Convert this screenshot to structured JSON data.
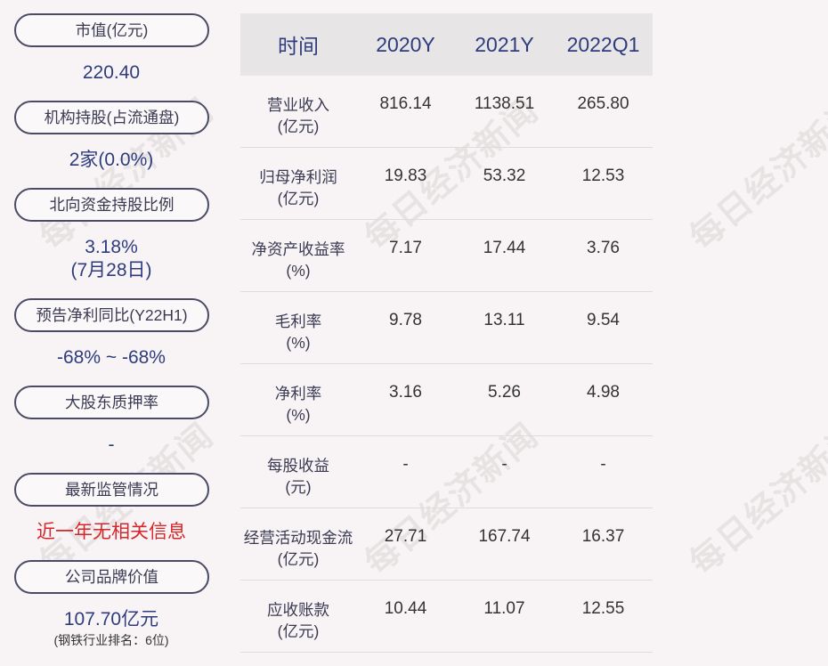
{
  "left_panel": [
    {
      "label": "市值(亿元)",
      "value": "220.40"
    },
    {
      "label": "机构持股(占流通盘)",
      "value": "2家(0.0%)"
    },
    {
      "label": "北向资金持股比例",
      "value": "3.18%",
      "value2": "(7月28日)"
    },
    {
      "label": "预告净利同比(Y22H1)",
      "value": "-68% ~ -68%"
    },
    {
      "label": "大股东质押率",
      "value": "-"
    },
    {
      "label": "最新监管情况",
      "value": "近一年无相关信息"
    },
    {
      "label": "公司品牌价值",
      "value": "107.70亿元",
      "sub": "(钢铁行业排名：6位)"
    }
  ],
  "table": {
    "headers": [
      "时间",
      "2020Y",
      "2021Y",
      "2022Q1"
    ],
    "rows": [
      {
        "label1": "营业收入",
        "label2": "(亿元)",
        "values": [
          "816.14",
          "1138.51",
          "265.80"
        ]
      },
      {
        "label1": "归母净利润",
        "label2": "(亿元)",
        "values": [
          "19.83",
          "53.32",
          "12.53"
        ]
      },
      {
        "label1": "净资产收益率",
        "label2": "(%)",
        "values": [
          "7.17",
          "17.44",
          "3.76"
        ]
      },
      {
        "label1": "毛利率",
        "label2": "(%)",
        "values": [
          "9.78",
          "13.11",
          "9.54"
        ]
      },
      {
        "label1": "净利率",
        "label2": "(%)",
        "values": [
          "3.16",
          "5.26",
          "4.98"
        ]
      },
      {
        "label1": "每股收益",
        "label2": "(元)",
        "values": [
          "-",
          "-",
          "-"
        ]
      },
      {
        "label1": "经营活动现金流",
        "label2": "(亿元)",
        "values": [
          "27.71",
          "167.74",
          "16.37"
        ]
      },
      {
        "label1": "应收账款",
        "label2": "(亿元)",
        "values": [
          "10.44",
          "11.07",
          "12.55"
        ]
      }
    ]
  },
  "watermark": "每日经济新闻",
  "colors": {
    "accent": "#2e3c7e",
    "alert": "#d7262a",
    "header_bg": "#e8e5e6",
    "background": "#f8f4f5"
  }
}
